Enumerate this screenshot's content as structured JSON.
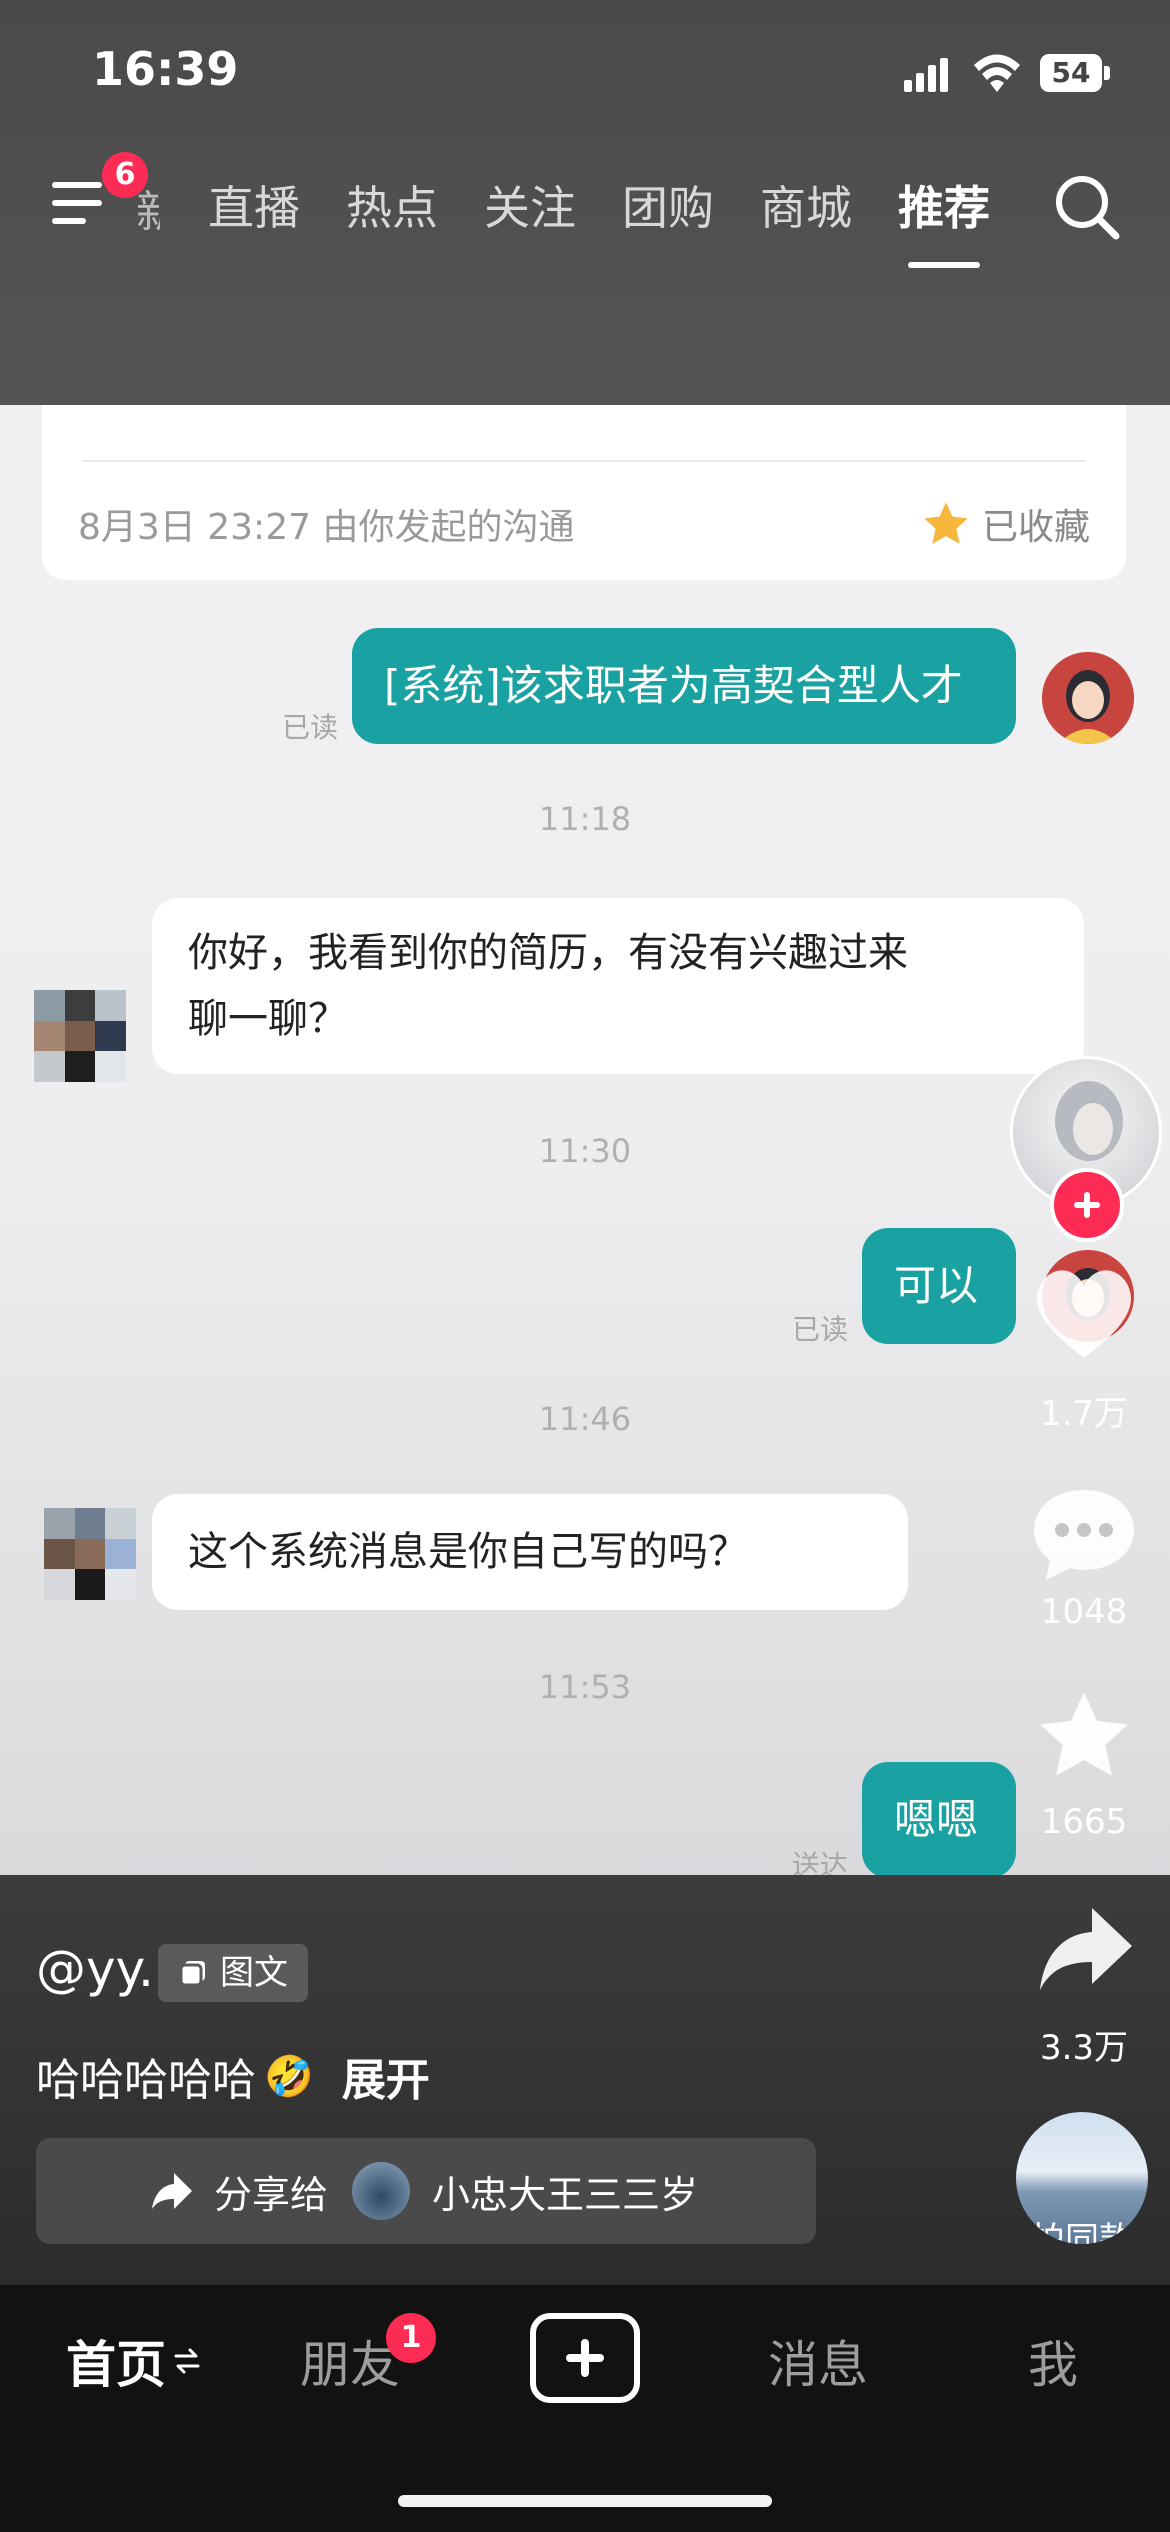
{
  "status": {
    "time": "16:39",
    "battery": "54"
  },
  "topnav": {
    "menu_badge": "6",
    "partial_tab": "新",
    "tabs": [
      "直播",
      "热点",
      "关注",
      "团购",
      "商城",
      "推荐"
    ],
    "active_tab": "推荐"
  },
  "chat": {
    "card_meta": "8月3日  23:27  由你发起的沟通",
    "saved_label": "已收藏",
    "messages": [
      {
        "text": "[系统]该求职者为高契合型人才",
        "status": "已读"
      },
      {
        "time": "11:18"
      },
      {
        "text_line1": "你好，我看到你的简历，有没有兴趣过来",
        "text_line2": "聊一聊？"
      },
      {
        "time": "11:30"
      },
      {
        "text": "可以",
        "status": "已读"
      },
      {
        "time": "11:46"
      },
      {
        "text": "这个系统消息是你自己写的吗？"
      },
      {
        "time": "11:53"
      },
      {
        "text": "嗯嗯",
        "status": "送达"
      }
    ]
  },
  "rail": {
    "likes": "1.7万",
    "comments": "1048",
    "favorites": "1665",
    "shares": "3.3万",
    "same_style_label": "拍同款"
  },
  "post": {
    "author": "@yy.",
    "type_tag": "图文",
    "caption": "哈哈哈哈哈",
    "emoji": "🤣",
    "expand_label": "展开",
    "share_prefix": "分享给",
    "share_target": "小忠大王三三岁"
  },
  "bottomnav": {
    "home": "首页",
    "friends": "朋友",
    "friends_badge": "1",
    "messages": "消息",
    "me": "我"
  },
  "colors": {
    "accent": "#1aa1a1",
    "badge": "#fe2c55",
    "nav_bg": "#121212"
  }
}
